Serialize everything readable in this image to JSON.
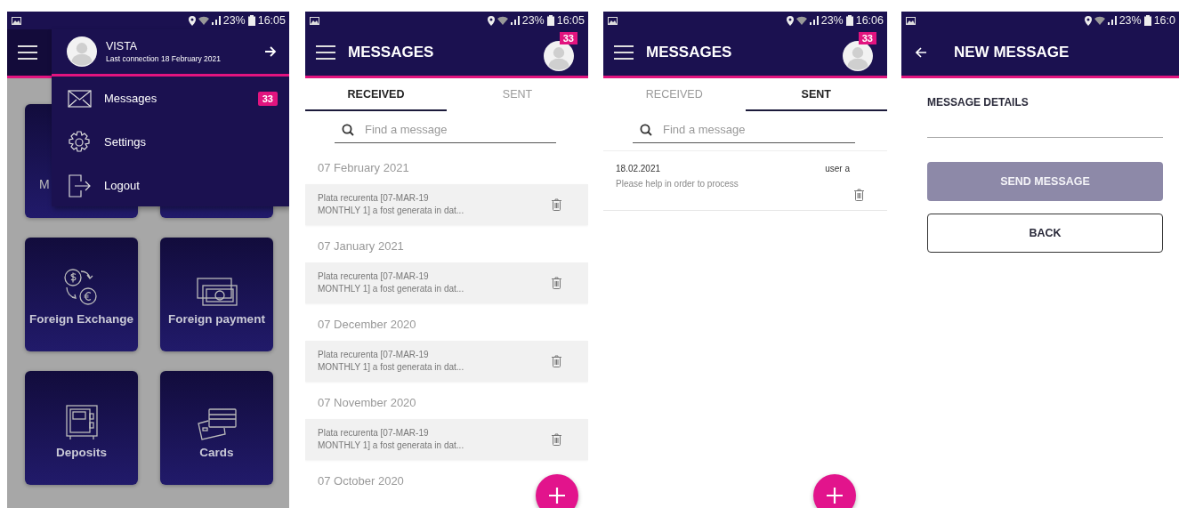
{
  "screens": [
    {
      "kind": "drawer",
      "status": {
        "battery": "23%",
        "time": "16:05"
      },
      "tiles": [
        {
          "label": "M",
          "kind": "partial"
        },
        {
          "label": "Foreign Exchange",
          "kind": "full"
        },
        {
          "label": "Foreign payment",
          "kind": "full"
        },
        {
          "label": "Deposits",
          "kind": "full"
        },
        {
          "label": "Cards",
          "kind": "full"
        }
      ],
      "drawer": {
        "user_name": "VISTA",
        "last_connection": "Last connection 18 February 2021",
        "items": [
          {
            "label": "Messages",
            "badge": "33"
          },
          {
            "label": "Settings"
          },
          {
            "label": "Logout"
          }
        ]
      }
    },
    {
      "kind": "messages",
      "status": {
        "battery": "23%",
        "time": "16:05"
      },
      "title": "MESSAGES",
      "badge": "33",
      "tabs": [
        {
          "label": "RECEIVED",
          "selected": true
        },
        {
          "label": "SENT",
          "selected": false
        }
      ],
      "search": {
        "placeholder": "Find a message"
      },
      "groups": [
        {
          "date": "07 February 2021",
          "messages": [
            {
              "text": "Plata recurenta [07-MAR-19\nMONTHLY 1] a fost generata in dat..."
            }
          ]
        },
        {
          "date": "07 January 2021",
          "messages": [
            {
              "text": "Plata recurenta [07-MAR-19\nMONTHLY 1] a fost generata in dat..."
            }
          ]
        },
        {
          "date": "07 December 2020",
          "messages": [
            {
              "text": "Plata recurenta [07-MAR-19\nMONTHLY 1] a fost generata in dat..."
            }
          ]
        },
        {
          "date": "07 November 2020",
          "messages": [
            {
              "text": "Plata recurenta [07-MAR-19\nMONTHLY 1] a fost generata in dat..."
            }
          ]
        },
        {
          "date": "07 October 2020"
        }
      ]
    },
    {
      "kind": "messages",
      "status": {
        "battery": "23%",
        "time": "16:06"
      },
      "title": "MESSAGES",
      "badge": "33",
      "tabs": [
        {
          "label": "RECEIVED",
          "selected": false
        },
        {
          "label": "SENT",
          "selected": true
        }
      ],
      "search": {
        "placeholder": "Find a message"
      },
      "sent": [
        {
          "date": "18.02.2021",
          "recipient": "user a",
          "text": "Please help in order to process"
        }
      ]
    },
    {
      "kind": "compose",
      "status": {
        "battery": "23%",
        "time": "16:0"
      },
      "title": "NEW MESSAGE",
      "field_label": "MESSAGE DETAILS",
      "buttons": [
        {
          "label": "SEND MESSAGE",
          "disabled": true
        },
        {
          "label": "BACK",
          "disabled": false
        }
      ]
    }
  ]
}
